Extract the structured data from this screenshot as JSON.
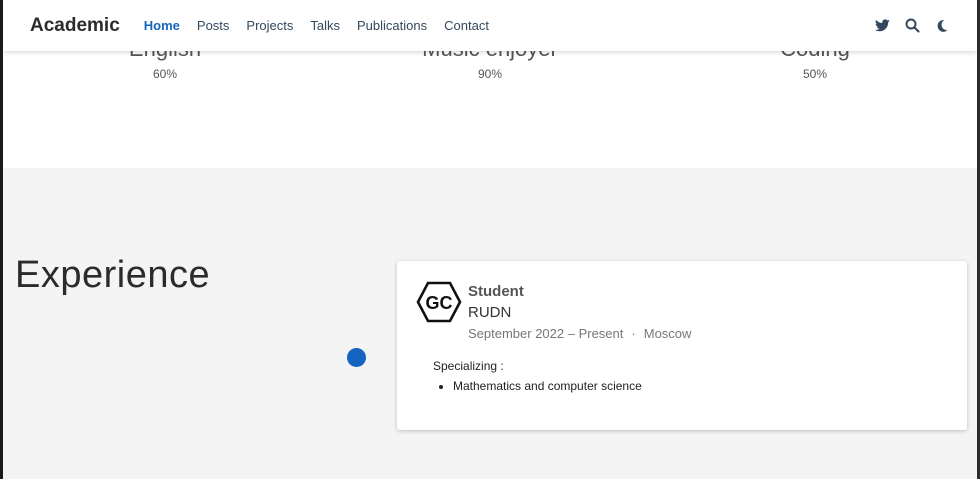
{
  "navbar": {
    "brand": "Academic",
    "links": [
      "Home",
      "Posts",
      "Projects",
      "Talks",
      "Publications",
      "Contact"
    ],
    "active_link": "Home",
    "icons": [
      "twitter-icon",
      "search-icon",
      "moon-icon"
    ],
    "accent_color": "#1565c0"
  },
  "skills": [
    {
      "name": "English",
      "percent": "60%"
    },
    {
      "name": "Music enjoyer",
      "percent": "90%"
    },
    {
      "name": "Coding",
      "percent": "50%"
    }
  ],
  "experience": {
    "title": "Experience",
    "items": [
      {
        "logo_text": "GC",
        "title": "Student",
        "organization": "RUDN",
        "dates": "September 2022 – Present",
        "separator": "·",
        "location": "Moscow",
        "description_heading": "Specializing :",
        "description_items": [
          "Mathematics and computer science"
        ]
      }
    ]
  }
}
